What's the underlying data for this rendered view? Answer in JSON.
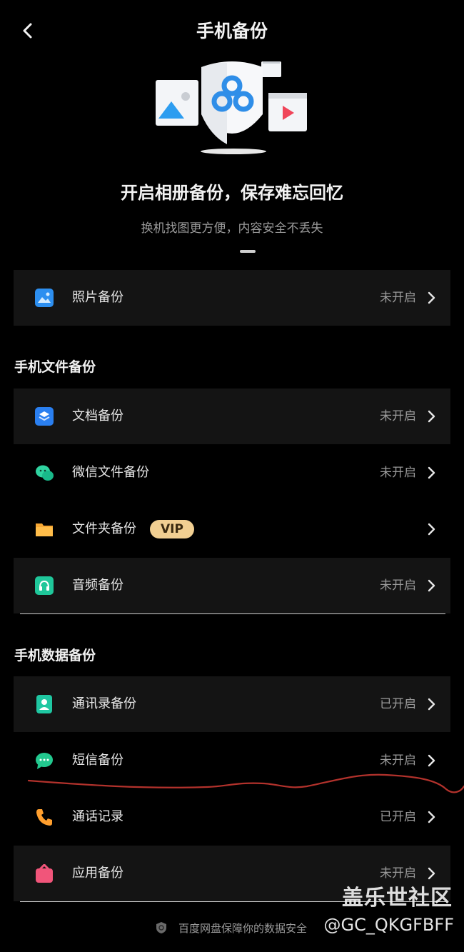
{
  "header": {
    "title": "手机备份"
  },
  "hero": {
    "headline": "开启相册备份，保存难忘回忆",
    "subline": "换机找图更方便，内容安全不丢失"
  },
  "photo_row": {
    "label": "照片备份",
    "status": "未开启",
    "icon": "photo-icon"
  },
  "files_section": {
    "title": "手机文件备份",
    "rows": [
      {
        "label": "文档备份",
        "status": "未开启",
        "icon": "document-icon"
      },
      {
        "label": "微信文件备份",
        "status": "未开启",
        "icon": "wechat-icon"
      },
      {
        "label": "文件夹备份",
        "badge": "VIP",
        "icon": "folder-icon"
      },
      {
        "label": "音频备份",
        "status": "未开启",
        "icon": "audio-icon"
      }
    ]
  },
  "data_section": {
    "title": "手机数据备份",
    "rows": [
      {
        "label": "通讯录备份",
        "status": "已开启",
        "icon": "contacts-icon"
      },
      {
        "label": "短信备份",
        "status": "未开启",
        "icon": "sms-icon"
      },
      {
        "label": "通话记录",
        "status": "已开启",
        "icon": "phone-icon"
      },
      {
        "label": "应用备份",
        "status": "未开启",
        "icon": "app-icon"
      }
    ]
  },
  "footer": {
    "text": "百度网盘保障你的数据安全"
  },
  "watermark": {
    "line1": "盖乐世社区",
    "line2": "@GC_QKGFBFF"
  },
  "colors": {
    "background": "#000000",
    "card": "#141414",
    "vip_badge": "#f1cf92",
    "brand_blue": "#2f8ee8",
    "annotation_red": "#b3322c"
  }
}
